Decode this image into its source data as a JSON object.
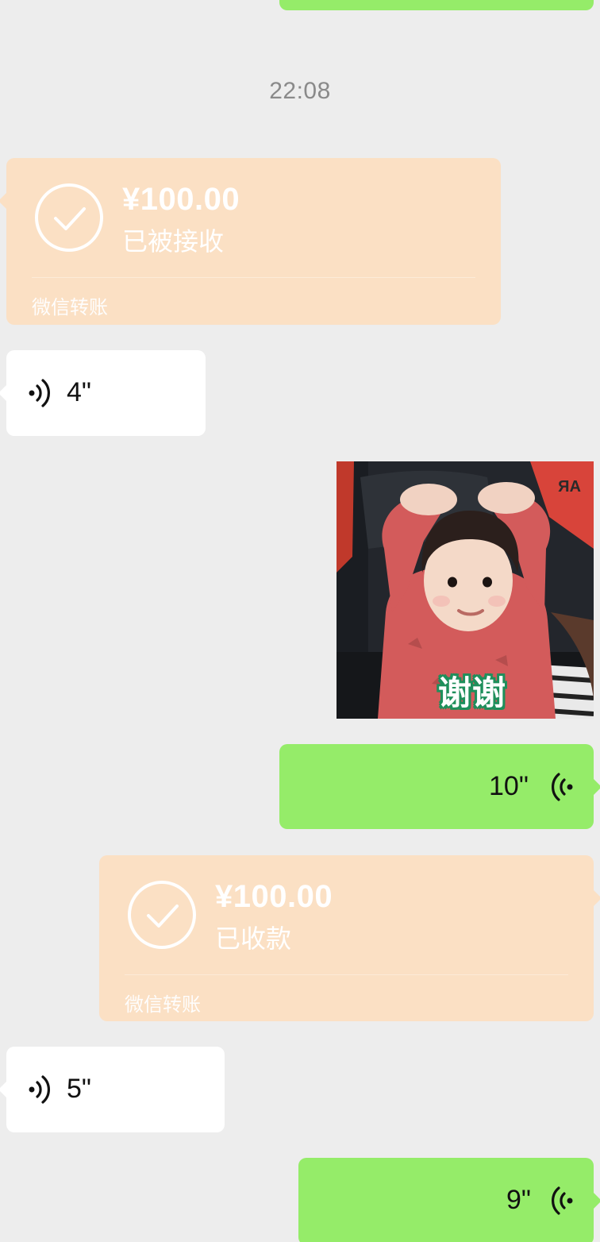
{
  "timestamp": "22:08",
  "messages": {
    "transfer1": {
      "amount": "¥100.00",
      "status": "已被接收",
      "label": "微信转账"
    },
    "voice1": {
      "duration": "4\""
    },
    "sticker": {
      "caption": "谢谢",
      "background_text": "AR"
    },
    "voice2": {
      "duration": "10\""
    },
    "transfer2": {
      "amount": "¥100.00",
      "status": "已收款",
      "label": "微信转账"
    },
    "voice3": {
      "duration": "5\""
    },
    "voice4": {
      "duration": "9\""
    }
  },
  "colors": {
    "background": "#ededed",
    "transfer_bubble": "#fbe0c4",
    "outgoing_bubble": "#95ec69",
    "incoming_bubble": "#ffffff"
  },
  "icons": [
    "check-icon",
    "voice-wave-icon"
  ]
}
